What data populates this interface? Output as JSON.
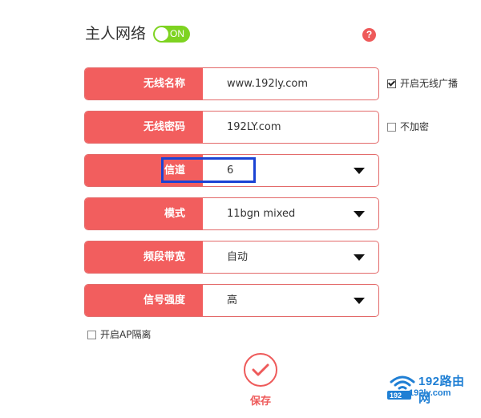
{
  "header": {
    "title": "主人网络",
    "toggle_label": "ON",
    "toggle_state": "on",
    "help_glyph": "?"
  },
  "fields": [
    {
      "label": "无线名称",
      "value": "www.192ly.com",
      "type": "text"
    },
    {
      "label": "无线密码",
      "value": "192LY.com",
      "type": "text"
    },
    {
      "label": "信道",
      "value": "6",
      "type": "select"
    },
    {
      "label": "模式",
      "value": "11bgn mixed",
      "type": "select"
    },
    {
      "label": "频段带宽",
      "value": "自动",
      "type": "select"
    },
    {
      "label": "信号强度",
      "value": "高",
      "type": "select"
    }
  ],
  "side_options": {
    "broadcast_label": "开启无线广播",
    "broadcast_checked": true,
    "no_encrypt_label": "不加密",
    "no_encrypt_checked": false
  },
  "ap_isolation": {
    "label": "开启AP隔离",
    "checked": false
  },
  "save": {
    "label": "保存"
  },
  "watermark": {
    "title": "192路由网",
    "url": "192ly.com",
    "badge": "192"
  },
  "colors": {
    "accent": "#f25e5e",
    "toggle_on": "#7ed321",
    "highlight": "#1b43d4",
    "watermark": "#1f7fd4"
  }
}
